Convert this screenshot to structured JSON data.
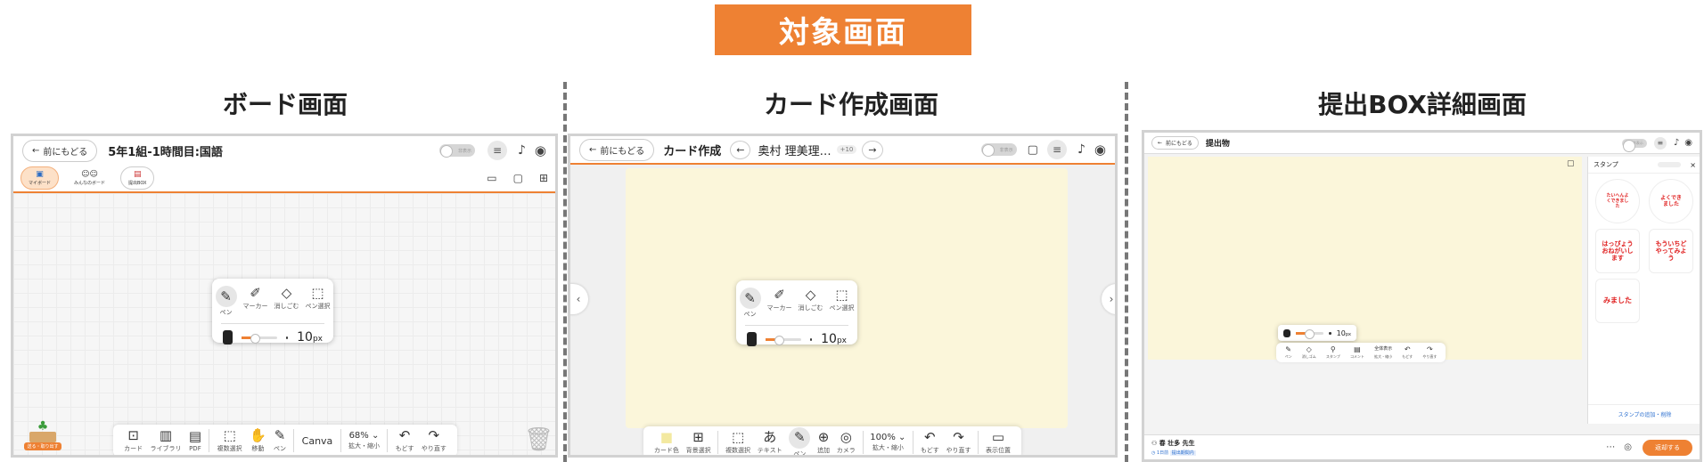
{
  "banner": "対象画面",
  "sections": {
    "board": "ボード画面",
    "card": "カード作成画面",
    "box": "提出BOX詳細画面"
  },
  "common": {
    "back": "前にもどる",
    "toggle": "非表示"
  },
  "board": {
    "title": "5年1組-1時間目:国語",
    "tabs": [
      "マイボード",
      "みんなのボード",
      "提出BOX"
    ],
    "pen_tools": [
      "ペン",
      "マーカー",
      "消しごむ",
      "ペン選択"
    ],
    "size_value": "10",
    "size_unit": "px",
    "bottom_tools": [
      "カード",
      "ライブラリ",
      "PDF",
      "複数選択",
      "移動",
      "ペン",
      "拡大・縮小",
      "もどす",
      "やり直す"
    ],
    "canva": "Canva",
    "zoom": "68%",
    "plant": "送る・取り出す"
  },
  "card": {
    "title": "カード作成",
    "student": "奥村 理美理…",
    "badge": "+10",
    "pen_tools": [
      "ペン",
      "マーカー",
      "消しごむ",
      "ペン選択"
    ],
    "size_value": "10",
    "size_unit": "px",
    "bottom_tools": [
      "カード色",
      "背景選択",
      "複数選択",
      "テキスト",
      "ペン",
      "追加",
      "カメラ",
      "拡大・縮小",
      "もどす",
      "やり直す",
      "表示位置"
    ],
    "zoom": "100%"
  },
  "box": {
    "title": "提出物",
    "size_value": "10",
    "size_unit": "px",
    "tools": [
      "ペン",
      "消しゴム",
      "スタンプ",
      "コメント",
      "拡大・縮小",
      "もどす",
      "やり直す"
    ],
    "view": "全体表示",
    "stamp_title": "スタンプ",
    "stamp_link": "スタンプの追加・削除",
    "stamps": [
      "たいへんよくできました",
      "よくできました",
      "はっぴょうおねがいします",
      "もういちどやってみよう",
      "みました"
    ],
    "teacher": "春 壮多 先生",
    "time": "1日前",
    "status": "提出期間内",
    "submit": "返却する"
  },
  "colors": {
    "accent": "#ee8133",
    "card_bg": "#fbf6da",
    "stamp_red": "#e02020"
  }
}
